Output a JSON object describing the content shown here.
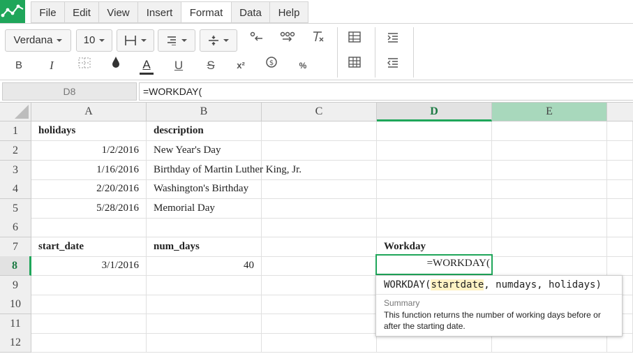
{
  "menu": [
    "File",
    "Edit",
    "View",
    "Insert",
    "Format",
    "Data",
    "Help"
  ],
  "menu_active": "Format",
  "toolbar": {
    "font_family": "Verdana",
    "font_size": "10",
    "bold": "B",
    "italic": "I",
    "text_color": "A",
    "underline": "U",
    "strike": "S",
    "superscript": "x²",
    "percent": "%"
  },
  "formula": {
    "cell_ref": "D8",
    "content": "=WORKDAY("
  },
  "columns": [
    "A",
    "B",
    "C",
    "D",
    "E"
  ],
  "rows": [
    "1",
    "2",
    "3",
    "4",
    "5",
    "6",
    "7",
    "8",
    "9",
    "10",
    "11",
    "12"
  ],
  "cells": {
    "A1": "holidays",
    "B1": "description",
    "A2": "1/2/2016",
    "B2": "New Year's Day",
    "A3": "1/16/2016",
    "B3": "Birthday of Martin Luther King, Jr.",
    "A4": "2/20/2016",
    "B4": "Washington's Birthday",
    "A5": "5/28/2016",
    "B5": "Memorial Day",
    "A7": "start_date",
    "B7": "num_days",
    "D7": "Workday",
    "A8": "3/1/2016",
    "B8": "40",
    "D8": "=WORKDAY("
  },
  "tooltip": {
    "fn": "WORKDAY(",
    "arg_active": "startdate",
    "rest": ", numdays, holidays)",
    "summary_label": "Summary",
    "description": "This function returns the number of working days before or after the starting date."
  },
  "colors": {
    "brand_green": "#1fa65a",
    "selection": "#1fa65a",
    "col_e_header": "#a8d8bc"
  }
}
